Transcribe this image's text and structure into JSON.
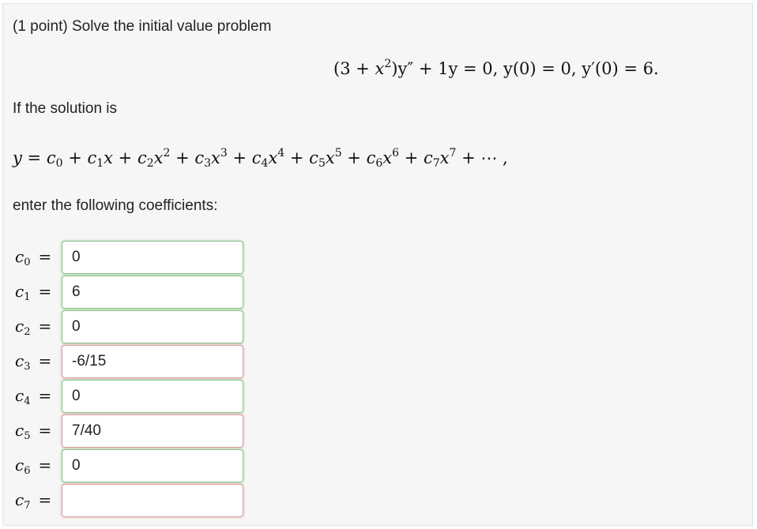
{
  "header": {
    "points": "(1 point)",
    "prompt": "Solve the initial value problem"
  },
  "ivp": {
    "lhs_open": "(3 + ",
    "var_x": "x",
    "exp2": "2",
    "close_y": ")y″ + 1y = 0,  ",
    "ic1": "y(0) = 0,  ",
    "ic2": "y′(0) = 6."
  },
  "intro": "If the solution is",
  "series_prefix": "y = ",
  "series_terms": [
    {
      "c": "c",
      "sub": "0",
      "x": "",
      "pow": ""
    },
    {
      "c": "c",
      "sub": "1",
      "x": "x",
      "pow": ""
    },
    {
      "c": "c",
      "sub": "2",
      "x": "x",
      "pow": "2"
    },
    {
      "c": "c",
      "sub": "3",
      "x": "x",
      "pow": "3"
    },
    {
      "c": "c",
      "sub": "4",
      "x": "x",
      "pow": "4"
    },
    {
      "c": "c",
      "sub": "5",
      "x": "x",
      "pow": "5"
    },
    {
      "c": "c",
      "sub": "6",
      "x": "x",
      "pow": "6"
    },
    {
      "c": "c",
      "sub": "7",
      "x": "x",
      "pow": "7"
    }
  ],
  "series_suffix": " + ⋯ ,",
  "instruction": "enter the following coefficients:",
  "coefficients": [
    {
      "symbol": "c",
      "sub": "0",
      "eq": "=",
      "value": "0",
      "status": "correct"
    },
    {
      "symbol": "c",
      "sub": "1",
      "eq": "=",
      "value": "6",
      "status": "correct"
    },
    {
      "symbol": "c",
      "sub": "2",
      "eq": "=",
      "value": "0",
      "status": "correct"
    },
    {
      "symbol": "c",
      "sub": "3",
      "eq": "=",
      "value": "-6/15",
      "status": "incorrect"
    },
    {
      "symbol": "c",
      "sub": "4",
      "eq": "=",
      "value": "0",
      "status": "correct"
    },
    {
      "symbol": "c",
      "sub": "5",
      "eq": "=",
      "value": "7/40",
      "status": "incorrect"
    },
    {
      "symbol": "c",
      "sub": "6",
      "eq": "=",
      "value": "0",
      "status": "correct"
    },
    {
      "symbol": "c",
      "sub": "7",
      "eq": "=",
      "value": "",
      "status": "incorrect"
    }
  ]
}
